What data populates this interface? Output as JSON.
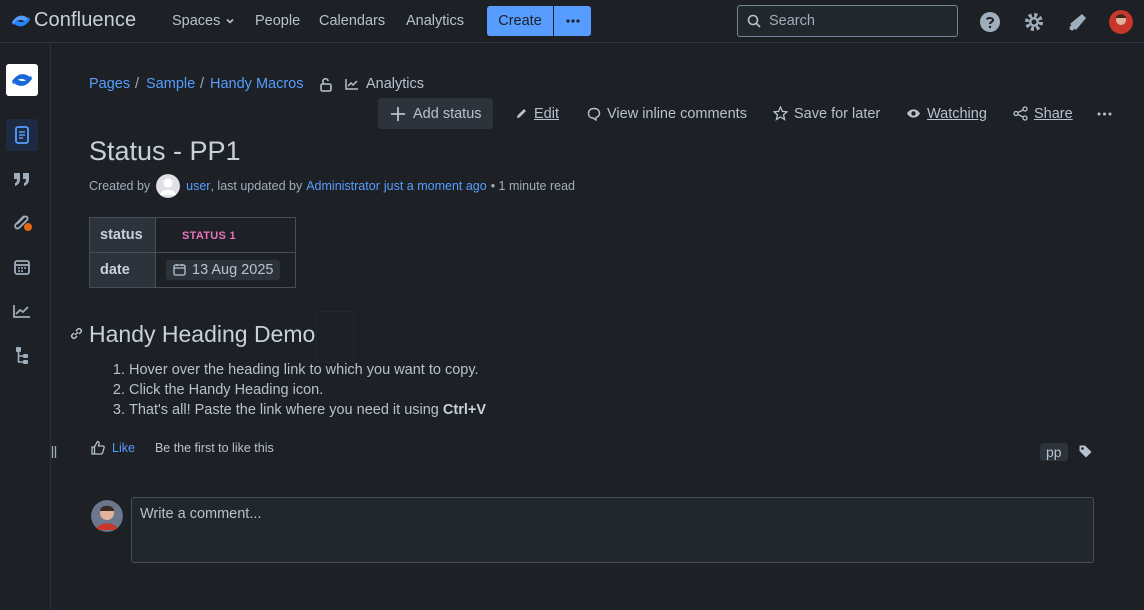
{
  "nav": {
    "brand": "Confluence",
    "items": [
      {
        "label": "Spaces"
      },
      {
        "label": "People"
      },
      {
        "label": "Calendars"
      },
      {
        "label": "Analytics"
      }
    ],
    "create_label": "Create",
    "search_placeholder": "Search"
  },
  "breadcrumb": {
    "items": [
      "Pages",
      "Sample",
      "Handy Macros"
    ],
    "analytics_label": "Analytics"
  },
  "toolbar": {
    "add_status": "Add status",
    "edit": "Edit",
    "view_comments": "View inline comments",
    "save_later": "Save for later",
    "watching": "Watching",
    "share": "Share"
  },
  "page": {
    "title": "Status - PP1",
    "byline": {
      "created_by": "Created by",
      "user": "user",
      "updated_by": ", last updated by",
      "admin": "Administrator",
      "when": "just a moment ago",
      "read_time": "• 1 minute read"
    },
    "properties": [
      {
        "key": "status",
        "value": "STATUS 1"
      },
      {
        "key": "date",
        "value": "13 Aug 2025"
      }
    ],
    "heading": "Handy Heading Demo",
    "steps": [
      "Hover over the heading link to which you want to copy.",
      "Click the Handy Heading icon.",
      "That's all! Paste the link where you need it using "
    ],
    "step3_bold": "Ctrl+V"
  },
  "footer": {
    "like_label": "Like",
    "like_text": "Be the first to like this",
    "tag": "pp",
    "comment_placeholder": "Write a comment..."
  },
  "colors": {
    "accent": "#579dff",
    "status_text": "#e774bb",
    "background": "#1d2125"
  }
}
